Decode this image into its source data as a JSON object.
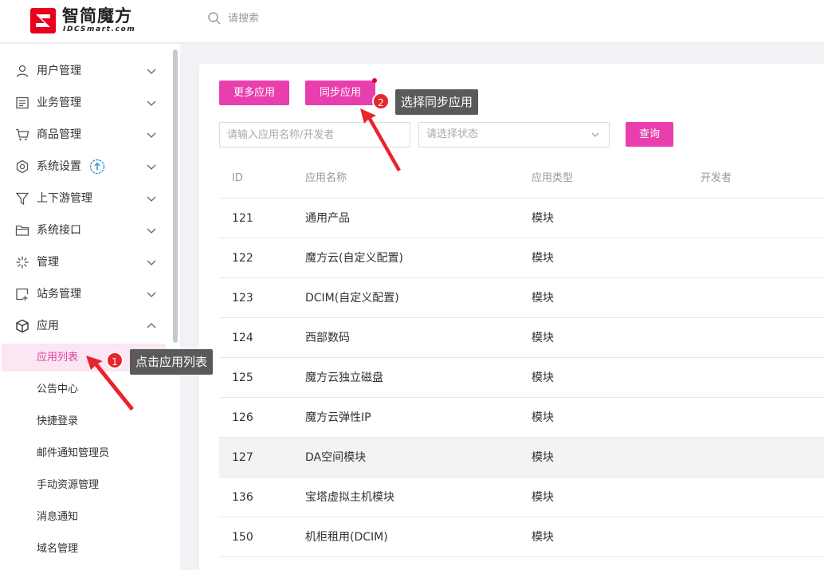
{
  "header": {
    "logo_cn": "智简魔方",
    "logo_en": "IDCSmart.com",
    "search_placeholder": "请搜索"
  },
  "sidebar": {
    "menu": [
      {
        "label": "用户管理",
        "icon": "user-icon"
      },
      {
        "label": "业务管理",
        "icon": "list-icon"
      },
      {
        "label": "商品管理",
        "icon": "cart-icon"
      },
      {
        "label": "系统设置",
        "icon": "settings-icon"
      },
      {
        "label": "上下游管理",
        "icon": "funnel-icon"
      },
      {
        "label": "系统接口",
        "icon": "folder-icon"
      },
      {
        "label": "管理",
        "icon": "sparkle-icon"
      },
      {
        "label": "站务管理",
        "icon": "site-icon"
      },
      {
        "label": "应用",
        "icon": "cube-icon"
      }
    ],
    "submenu": [
      {
        "label": "应用列表",
        "active": true
      },
      {
        "label": "公告中心"
      },
      {
        "label": "快捷登录"
      },
      {
        "label": "邮件通知管理员"
      },
      {
        "label": "手动资源管理"
      },
      {
        "label": "消息通知"
      },
      {
        "label": "域名管理"
      }
    ]
  },
  "toolbar": {
    "more_apps": "更多应用",
    "sync_apps": "同步应用",
    "query": "查询"
  },
  "filters": {
    "app_placeholder": "请输入应用名称/开发者",
    "status_placeholder": "请选择状态"
  },
  "table": {
    "headers": {
      "id": "ID",
      "name": "应用名称",
      "type": "应用类型",
      "developer": "开发者"
    },
    "rows": [
      {
        "id": "121",
        "name": "通用产品",
        "type": "模块",
        "developer": ""
      },
      {
        "id": "122",
        "name": "魔方云(自定义配置)",
        "type": "模块",
        "developer": ""
      },
      {
        "id": "123",
        "name": "DCIM(自定义配置)",
        "type": "模块",
        "developer": ""
      },
      {
        "id": "124",
        "name": "西部数码",
        "type": "模块",
        "developer": ""
      },
      {
        "id": "125",
        "name": "魔方云独立磁盘",
        "type": "模块",
        "developer": ""
      },
      {
        "id": "126",
        "name": "魔方云弹性IP",
        "type": "模块",
        "developer": ""
      },
      {
        "id": "127",
        "name": "DA空间模块",
        "type": "模块",
        "developer": "",
        "hover": true
      },
      {
        "id": "136",
        "name": "宝塔虚拟主机模块",
        "type": "模块",
        "developer": ""
      },
      {
        "id": "150",
        "name": "机柜租用(DCIM)",
        "type": "模块",
        "developer": ""
      }
    ]
  },
  "annotations": {
    "step1": {
      "num": "1",
      "text": "点击应用列表"
    },
    "step2": {
      "num": "2",
      "text": "选择同步应用"
    }
  },
  "colors": {
    "accent": "#e93fae",
    "active_bg": "#fbe6f3",
    "annotation_red": "#e8242c",
    "tooltip_bg": "#5a5a5a",
    "logo_red": "#e8001c"
  }
}
